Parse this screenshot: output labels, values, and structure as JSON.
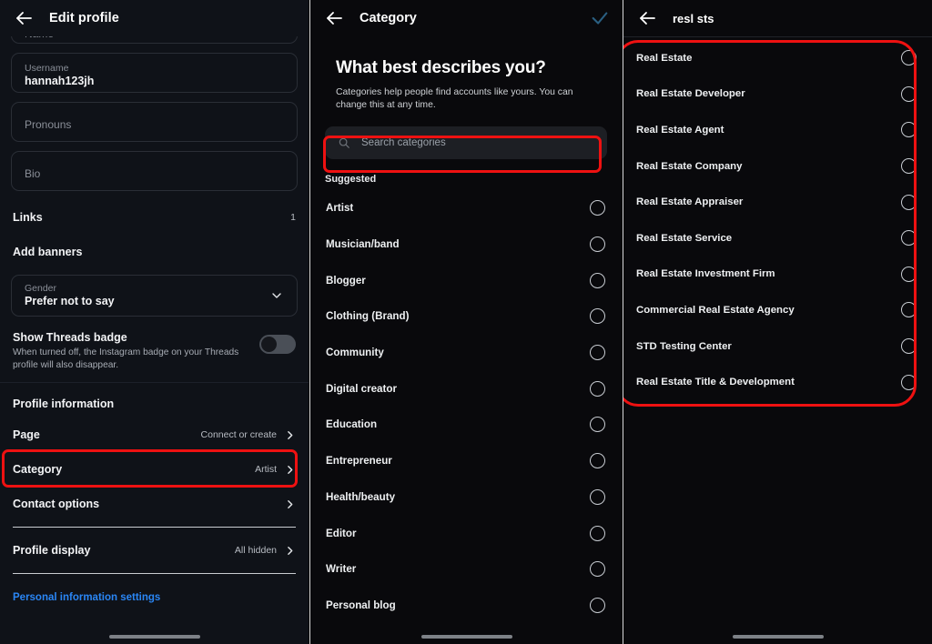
{
  "panel1": {
    "header": {
      "back_icon": "arrow-left-icon",
      "title": "Edit profile"
    },
    "fields": [
      {
        "label": "Name",
        "value": "",
        "clipped": true
      },
      {
        "label": "Username",
        "value": "hannah123jh",
        "clipped": false
      },
      {
        "label": "Pronouns",
        "value": "",
        "clipped": false
      },
      {
        "label": "Bio",
        "value": "",
        "clipped": false
      }
    ],
    "links_row": {
      "label": "Links",
      "count": "1"
    },
    "add_banners": {
      "label": "Add banners"
    },
    "gender": {
      "label": "Gender",
      "value": "Prefer not to say",
      "chevron_icon": "chevron-down-icon"
    },
    "threads_badge": {
      "title": "Show Threads badge",
      "description": "When turned off, the Instagram badge on your Threads profile will also disappear.",
      "enabled": false
    },
    "profile_information_title": "Profile information",
    "nav_rows": [
      {
        "label": "Page",
        "value": "Connect or create",
        "chevron_icon": "chevron-right-icon"
      },
      {
        "label": "Category",
        "value": "Artist",
        "chevron_icon": "chevron-right-icon"
      },
      {
        "label": "Contact options",
        "value": "",
        "chevron_icon": "chevron-right-icon"
      },
      {
        "label": "Profile display",
        "value": "All hidden",
        "chevron_icon": "chevron-right-icon"
      }
    ],
    "personal_info_link": "Personal information settings"
  },
  "panel2": {
    "header": {
      "back_icon": "arrow-left-icon",
      "title": "Category",
      "confirm_icon": "check-icon"
    },
    "heading": "What best describes you?",
    "subtext": "Categories help people find accounts like yours. You can change this at any time.",
    "search": {
      "icon": "search-icon",
      "placeholder": "Search categories",
      "value": ""
    },
    "section_label": "Suggested",
    "categories": [
      {
        "label": "Artist",
        "selected": false
      },
      {
        "label": "Musician/band",
        "selected": false
      },
      {
        "label": "Blogger",
        "selected": false
      },
      {
        "label": "Clothing (Brand)",
        "selected": false
      },
      {
        "label": "Community",
        "selected": false
      },
      {
        "label": "Digital creator",
        "selected": false
      },
      {
        "label": "Education",
        "selected": false
      },
      {
        "label": "Entrepreneur",
        "selected": false
      },
      {
        "label": "Health/beauty",
        "selected": false
      },
      {
        "label": "Editor",
        "selected": false
      },
      {
        "label": "Writer",
        "selected": false
      },
      {
        "label": "Personal blog",
        "selected": false
      }
    ]
  },
  "panel3": {
    "header": {
      "back_icon": "arrow-left-icon",
      "title": "resl sts"
    },
    "results": [
      {
        "label": "Real Estate",
        "selected": false
      },
      {
        "label": "Real Estate Developer",
        "selected": false
      },
      {
        "label": "Real Estate Agent",
        "selected": false
      },
      {
        "label": "Real Estate Company",
        "selected": false
      },
      {
        "label": "Real Estate Appraiser",
        "selected": false
      },
      {
        "label": "Real Estate Service",
        "selected": false
      },
      {
        "label": "Real Estate Investment Firm",
        "selected": false
      },
      {
        "label": "Commercial Real Estate Agency",
        "selected": false
      },
      {
        "label": "STD Testing Center",
        "selected": false
      },
      {
        "label": "Real Estate Title & Development",
        "selected": false
      }
    ]
  },
  "annotations": {
    "highlight_color": "#ee1111",
    "boxes": [
      {
        "name": "category-row-highlight"
      },
      {
        "name": "search-field-highlight"
      },
      {
        "name": "search-results-highlight"
      }
    ]
  },
  "colors": {
    "accent_link": "#2a86f5",
    "confirm_check": "#2a5f82",
    "panel1_bg": "#0f1218",
    "panel_bg": "#09090c"
  }
}
